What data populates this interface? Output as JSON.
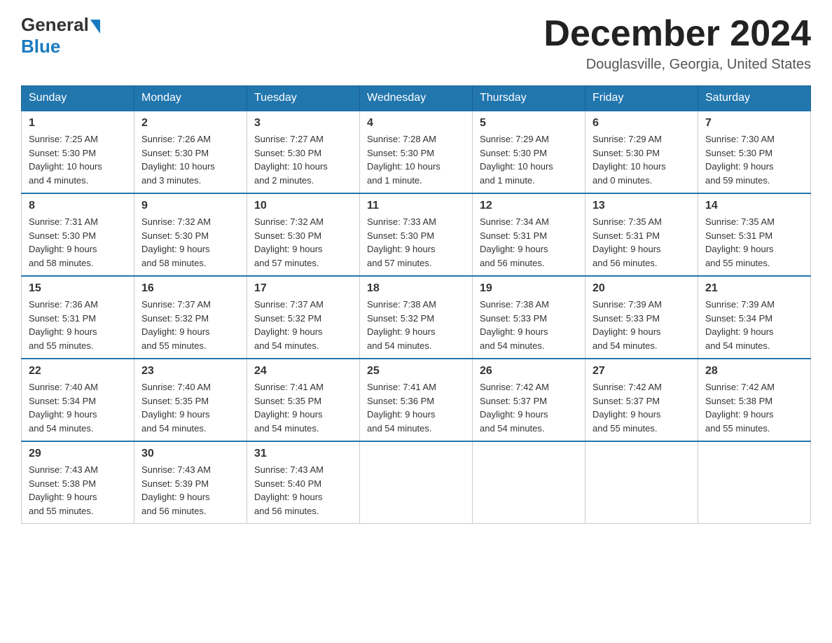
{
  "header": {
    "logo_general": "General",
    "logo_blue": "Blue",
    "month_title": "December 2024",
    "location": "Douglasville, Georgia, United States"
  },
  "days_of_week": [
    "Sunday",
    "Monday",
    "Tuesday",
    "Wednesday",
    "Thursday",
    "Friday",
    "Saturday"
  ],
  "weeks": [
    [
      {
        "day": "1",
        "sunrise": "7:25 AM",
        "sunset": "5:30 PM",
        "daylight": "10 hours and 4 minutes."
      },
      {
        "day": "2",
        "sunrise": "7:26 AM",
        "sunset": "5:30 PM",
        "daylight": "10 hours and 3 minutes."
      },
      {
        "day": "3",
        "sunrise": "7:27 AM",
        "sunset": "5:30 PM",
        "daylight": "10 hours and 2 minutes."
      },
      {
        "day": "4",
        "sunrise": "7:28 AM",
        "sunset": "5:30 PM",
        "daylight": "10 hours and 1 minute."
      },
      {
        "day": "5",
        "sunrise": "7:29 AM",
        "sunset": "5:30 PM",
        "daylight": "10 hours and 1 minute."
      },
      {
        "day": "6",
        "sunrise": "7:29 AM",
        "sunset": "5:30 PM",
        "daylight": "10 hours and 0 minutes."
      },
      {
        "day": "7",
        "sunrise": "7:30 AM",
        "sunset": "5:30 PM",
        "daylight": "9 hours and 59 minutes."
      }
    ],
    [
      {
        "day": "8",
        "sunrise": "7:31 AM",
        "sunset": "5:30 PM",
        "daylight": "9 hours and 58 minutes."
      },
      {
        "day": "9",
        "sunrise": "7:32 AM",
        "sunset": "5:30 PM",
        "daylight": "9 hours and 58 minutes."
      },
      {
        "day": "10",
        "sunrise": "7:32 AM",
        "sunset": "5:30 PM",
        "daylight": "9 hours and 57 minutes."
      },
      {
        "day": "11",
        "sunrise": "7:33 AM",
        "sunset": "5:30 PM",
        "daylight": "9 hours and 57 minutes."
      },
      {
        "day": "12",
        "sunrise": "7:34 AM",
        "sunset": "5:31 PM",
        "daylight": "9 hours and 56 minutes."
      },
      {
        "day": "13",
        "sunrise": "7:35 AM",
        "sunset": "5:31 PM",
        "daylight": "9 hours and 56 minutes."
      },
      {
        "day": "14",
        "sunrise": "7:35 AM",
        "sunset": "5:31 PM",
        "daylight": "9 hours and 55 minutes."
      }
    ],
    [
      {
        "day": "15",
        "sunrise": "7:36 AM",
        "sunset": "5:31 PM",
        "daylight": "9 hours and 55 minutes."
      },
      {
        "day": "16",
        "sunrise": "7:37 AM",
        "sunset": "5:32 PM",
        "daylight": "9 hours and 55 minutes."
      },
      {
        "day": "17",
        "sunrise": "7:37 AM",
        "sunset": "5:32 PM",
        "daylight": "9 hours and 54 minutes."
      },
      {
        "day": "18",
        "sunrise": "7:38 AM",
        "sunset": "5:32 PM",
        "daylight": "9 hours and 54 minutes."
      },
      {
        "day": "19",
        "sunrise": "7:38 AM",
        "sunset": "5:33 PM",
        "daylight": "9 hours and 54 minutes."
      },
      {
        "day": "20",
        "sunrise": "7:39 AM",
        "sunset": "5:33 PM",
        "daylight": "9 hours and 54 minutes."
      },
      {
        "day": "21",
        "sunrise": "7:39 AM",
        "sunset": "5:34 PM",
        "daylight": "9 hours and 54 minutes."
      }
    ],
    [
      {
        "day": "22",
        "sunrise": "7:40 AM",
        "sunset": "5:34 PM",
        "daylight": "9 hours and 54 minutes."
      },
      {
        "day": "23",
        "sunrise": "7:40 AM",
        "sunset": "5:35 PM",
        "daylight": "9 hours and 54 minutes."
      },
      {
        "day": "24",
        "sunrise": "7:41 AM",
        "sunset": "5:35 PM",
        "daylight": "9 hours and 54 minutes."
      },
      {
        "day": "25",
        "sunrise": "7:41 AM",
        "sunset": "5:36 PM",
        "daylight": "9 hours and 54 minutes."
      },
      {
        "day": "26",
        "sunrise": "7:42 AM",
        "sunset": "5:37 PM",
        "daylight": "9 hours and 54 minutes."
      },
      {
        "day": "27",
        "sunrise": "7:42 AM",
        "sunset": "5:37 PM",
        "daylight": "9 hours and 55 minutes."
      },
      {
        "day": "28",
        "sunrise": "7:42 AM",
        "sunset": "5:38 PM",
        "daylight": "9 hours and 55 minutes."
      }
    ],
    [
      {
        "day": "29",
        "sunrise": "7:43 AM",
        "sunset": "5:38 PM",
        "daylight": "9 hours and 55 minutes."
      },
      {
        "day": "30",
        "sunrise": "7:43 AM",
        "sunset": "5:39 PM",
        "daylight": "9 hours and 56 minutes."
      },
      {
        "day": "31",
        "sunrise": "7:43 AM",
        "sunset": "5:40 PM",
        "daylight": "9 hours and 56 minutes."
      },
      null,
      null,
      null,
      null
    ]
  ],
  "labels": {
    "sunrise": "Sunrise:",
    "sunset": "Sunset:",
    "daylight": "Daylight:"
  }
}
